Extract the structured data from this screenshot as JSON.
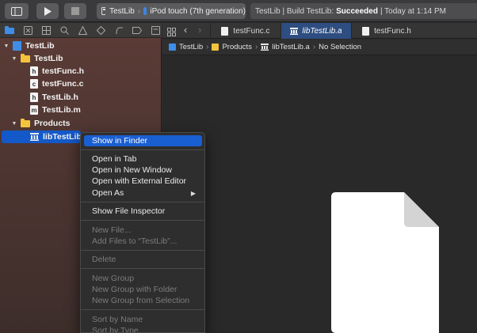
{
  "toolbar": {
    "scheme": {
      "target": "TestLib",
      "destination": "iPod touch (7th generation)"
    },
    "status": {
      "prefix": "TestLib | Build TestLib:",
      "result": "Succeeded",
      "suffix": "| Today at 1:14 PM"
    }
  },
  "navigator": {
    "tree": [
      {
        "label": "TestLib",
        "icon": "project-icon"
      },
      {
        "label": "TestLib",
        "icon": "folder-icon"
      },
      {
        "label": "testFunc.h",
        "icon": "header-file-icon",
        "glyph": "h"
      },
      {
        "label": "testFunc.c",
        "icon": "c-file-icon",
        "glyph": "c"
      },
      {
        "label": "TestLib.h",
        "icon": "header-file-icon",
        "glyph": "h"
      },
      {
        "label": "TestLib.m",
        "icon": "objc-file-icon",
        "glyph": "m"
      },
      {
        "label": "Products",
        "icon": "folder-icon"
      },
      {
        "label": "libTestLib.a",
        "icon": "library-icon"
      }
    ]
  },
  "tabs": [
    {
      "label": "testFunc.c",
      "icon": "c-file-icon"
    },
    {
      "label": "libTestLib.a",
      "icon": "library-icon"
    },
    {
      "label": "testFunc.h",
      "icon": "header-file-icon"
    }
  ],
  "jumpbar": [
    "TestLib",
    "Products",
    "libTestLib.a",
    "No Selection"
  ],
  "menu": {
    "show_in_finder": "Show in Finder",
    "open_in_tab": "Open in Tab",
    "open_in_new_window": "Open in New Window",
    "open_with_external_editor": "Open with External Editor",
    "open_as": "Open As",
    "show_file_inspector": "Show File Inspector",
    "new_file": "New File...",
    "add_files": "Add Files to “TestLib”...",
    "delete": "Delete",
    "new_group": "New Group",
    "new_group_with_folder": "New Group with Folder",
    "new_group_from_selection": "New Group from Selection",
    "sort_by_name": "Sort by Name",
    "sort_by_type": "Sort by Type"
  },
  "colors": {
    "selection": "#1a5fd2",
    "active_tab": "#2e4d80",
    "navigator_bg": "#5a3b36",
    "folder": "#f4c33c"
  }
}
